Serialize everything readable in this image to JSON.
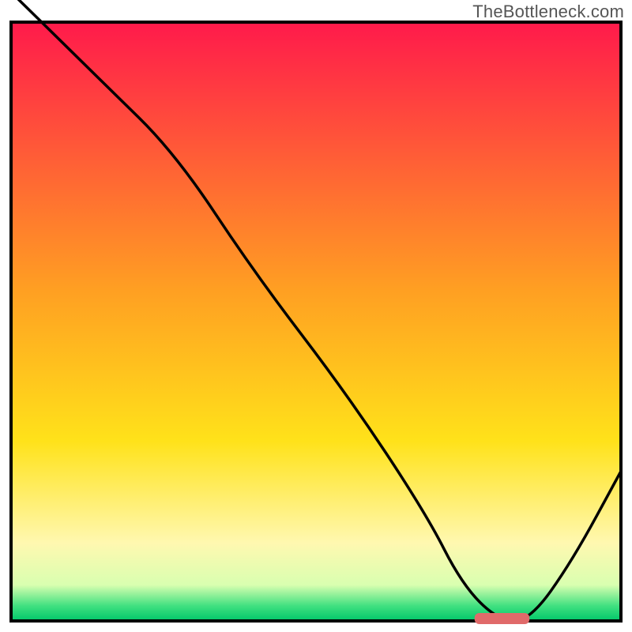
{
  "watermark": "TheBottleneck.com",
  "chart_data": {
    "type": "line",
    "title": "",
    "xlabel": "",
    "ylabel": "",
    "xlim": [
      0,
      100
    ],
    "ylim": [
      0,
      100
    ],
    "grid": false,
    "legend": false,
    "background_gradient": {
      "stops": [
        {
          "offset": 0.0,
          "color": "#ff1a4b"
        },
        {
          "offset": 0.45,
          "color": "#ffa022"
        },
        {
          "offset": 0.7,
          "color": "#ffe21a"
        },
        {
          "offset": 0.87,
          "color": "#fff8b0"
        },
        {
          "offset": 0.94,
          "color": "#d9ffb0"
        },
        {
          "offset": 0.975,
          "color": "#40e080"
        },
        {
          "offset": 1.0,
          "color": "#00c76a"
        }
      ]
    },
    "series": [
      {
        "name": "bottleneck-curve",
        "color": "#000000",
        "x": [
          0,
          5,
          15,
          27,
          40,
          55,
          68,
          74,
          80,
          85,
          92,
          100
        ],
        "values": [
          105,
          100,
          90,
          78,
          58,
          38,
          18,
          6,
          0,
          0,
          10,
          25
        ]
      }
    ],
    "marker": {
      "name": "optimal-range",
      "x_start": 76,
      "x_end": 85,
      "y": 0,
      "color": "#e06a6a"
    }
  }
}
